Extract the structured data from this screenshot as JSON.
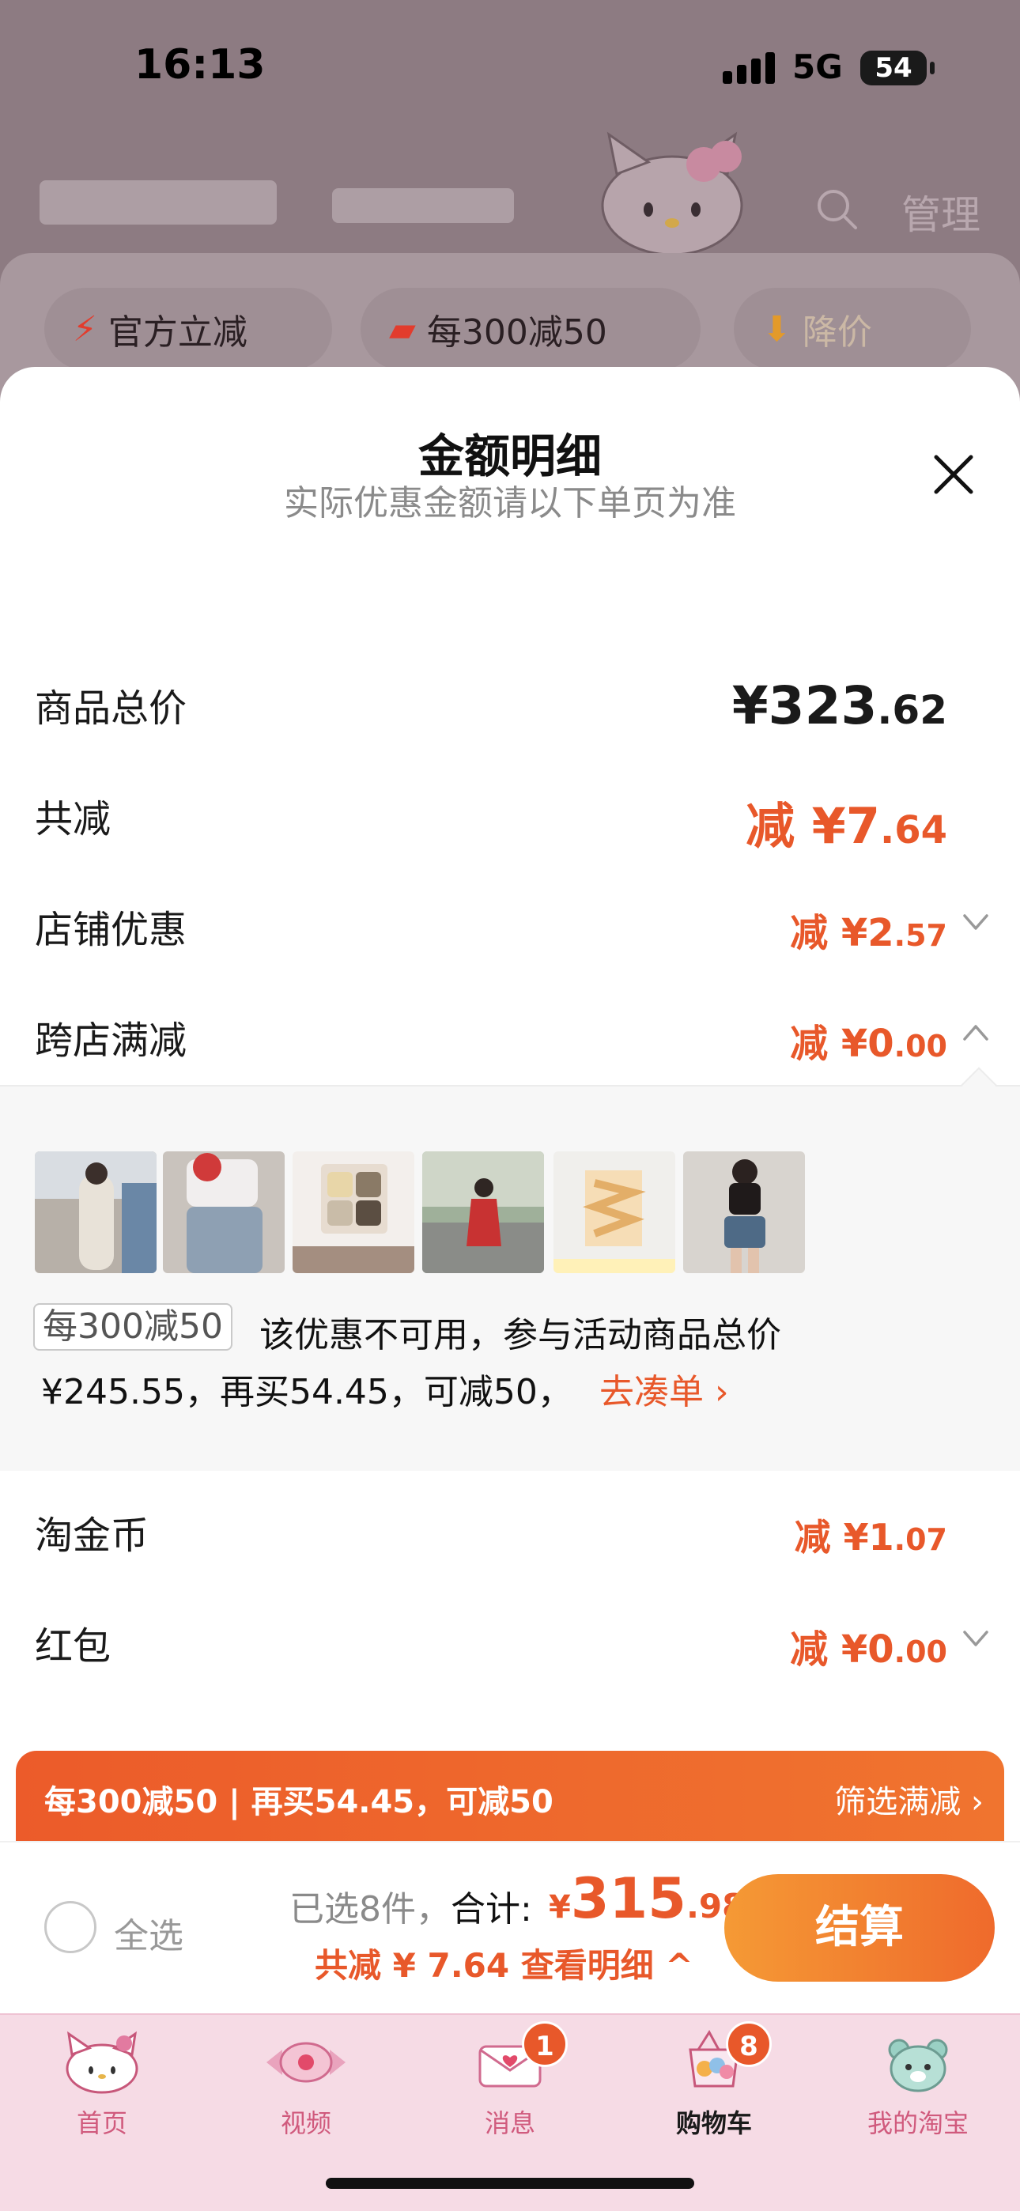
{
  "status_bar": {
    "time": "16:13",
    "network": "5G",
    "battery": "54"
  },
  "background": {
    "manage_label": "管理"
  },
  "filters": [
    {
      "icon": "bolt-icon",
      "label": "官方立减"
    },
    {
      "icon": "shop-icon",
      "label": "每300减50"
    },
    {
      "icon": "down-arrow-icon",
      "label": "降价"
    }
  ],
  "sheet": {
    "title": "金额明细",
    "subtitle": "实际优惠金额请以下单页为准",
    "rows": {
      "total": {
        "label": "商品总价",
        "value_main": "¥323",
        "value_decimal": ".62"
      },
      "reduce": {
        "label": "共减",
        "value_main": "减 ¥7",
        "value_decimal": ".64"
      },
      "shop": {
        "label": "店铺优惠",
        "value_main": "减 ¥2",
        "value_decimal": ".57"
      },
      "cross": {
        "label": "跨店满减",
        "value_main": "减 ¥0",
        "value_decimal": ".00"
      },
      "coin": {
        "label": "淘金币",
        "value_main": "减 ¥1",
        "value_decimal": ".07"
      },
      "redpack": {
        "label": "红包",
        "value_main": "减 ¥0",
        "value_decimal": ".00"
      }
    },
    "cross_panel": {
      "tag": "每300减50",
      "text_line1": "该优惠不可用，参与活动商品总价",
      "text_line2": "¥245.55，再买54.45，可减50，",
      "link": "去凑单 ›"
    }
  },
  "promo_bar": {
    "left": "每300减50 | 再买54.45，可减50",
    "right": "筛选满减 ›"
  },
  "checkout": {
    "select_all": "全选",
    "count_prefix": "已选8件，",
    "count_total_label": "合计:",
    "currency": "¥",
    "price_main": "315",
    "price_decimal": ".98",
    "reduce_line": "共减 ¥ 7.64  查看明细 ^",
    "button": "结算"
  },
  "tabs": [
    {
      "label": "首页",
      "icon": "kitty-home-icon"
    },
    {
      "label": "视频",
      "icon": "candy-video-icon"
    },
    {
      "label": "消息",
      "icon": "envelope-icon",
      "badge": "1"
    },
    {
      "label": "购物车",
      "icon": "cart-icon",
      "badge": "8"
    },
    {
      "label": "我的淘宝",
      "icon": "bear-icon"
    }
  ],
  "colors": {
    "accent": "#e8582a",
    "sheet_bg": "#ffffff",
    "tab_bg": "#f6dbe5"
  }
}
